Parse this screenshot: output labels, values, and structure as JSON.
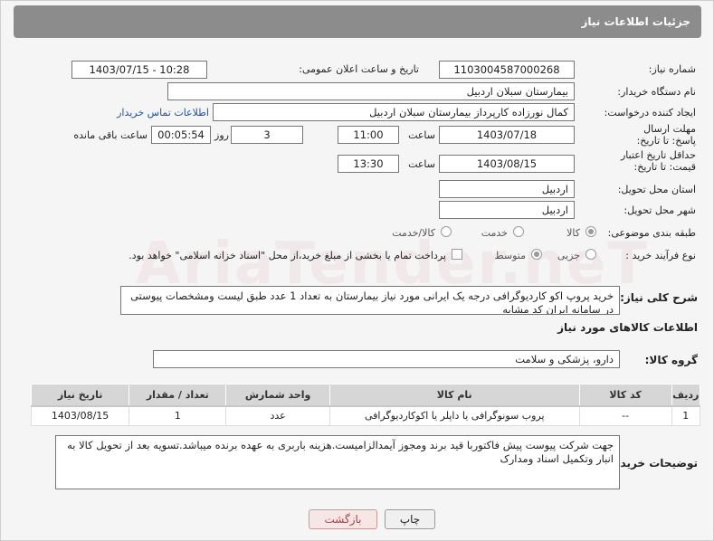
{
  "header": {
    "title": "جزئیات اطلاعات نیاز"
  },
  "fields": {
    "need_number_label": "شماره نیاز:",
    "need_number": "1103004587000268",
    "announce_label": "تاریخ و ساعت اعلان عمومی:",
    "announce_value": "1403/07/15 - 10:28",
    "buyer_org_label": "نام دستگاه خریدار:",
    "buyer_org": "بیمارستان سبلان اردبیل",
    "requester_label": "ایجاد کننده درخواست:",
    "requester": "کمال نورزاده کارپرداز بیمارستان سبلان اردبیل",
    "contact_link": "اطلاعات تماس خریدار",
    "deadline_label": "مهلت ارسال پاسخ: تا تاریخ:",
    "deadline_date": "1403/07/18",
    "time_word": "ساعت",
    "deadline_time": "11:00",
    "days_count": "3",
    "days_word": "روز و",
    "remaining_time": "00:05:54",
    "remaining_word": "ساعت باقی مانده",
    "validity_label": "حداقل تاریخ اعتبار قیمت: تا تاریخ:",
    "validity_date": "1403/08/15",
    "validity_time": "13:30",
    "province_label": "استان محل تحویل:",
    "province": "اردبیل",
    "city_label": "شهر محل تحویل:",
    "city": "اردبیل",
    "category_label": "طبقه بندی موضوعی:",
    "category_options": [
      "کالا",
      "خدمت",
      "کالا/خدمت"
    ],
    "purchase_type_label": "نوع فرآیند خرید :",
    "purchase_options": [
      "جزیی",
      "متوسط"
    ],
    "payment_note": "پرداخت تمام یا بخشی از مبلغ خرید،از محل \"اسناد خزانه اسلامی\" خواهد بود."
  },
  "description": {
    "label": "شرح کلی نیاز:",
    "text": "خرید پروپ اکو کاردیوگرافی درجه یک ایرانی مورد نیاز بیمارستان به تعداد 1 عدد طبق لیست ومشخصات پیوستی در سامانه ایران کد مشابه"
  },
  "goods": {
    "section_title": "اطلاعات کالاهای مورد نیاز",
    "group_label": "گروه کالا:",
    "group_value": "دارو، پزشکی و سلامت",
    "columns": [
      "ردیف",
      "کد کالا",
      "نام کالا",
      "واحد شمارش",
      "تعداد / مقدار",
      "تاریخ نیاز"
    ],
    "rows": [
      [
        "1",
        "--",
        "پروب سونوگرافی یا داپلر یا اکوکاردیوگرافی",
        "عدد",
        "1",
        "1403/08/15"
      ]
    ]
  },
  "buyer_notes": {
    "label": "توضیحات خریدار:",
    "text": "جهت شرکت پیوست پیش فاکتوربا قید برند ومجوز آیمدالزامیست.هزینه باربری به عهده برنده میباشد.تسویه بعد از تحویل کالا به انبار وتکمیل اسناد ومدارک"
  },
  "buttons": {
    "print": "چاپ",
    "back": "بازگشت"
  },
  "watermark": "AriaTender.neT"
}
